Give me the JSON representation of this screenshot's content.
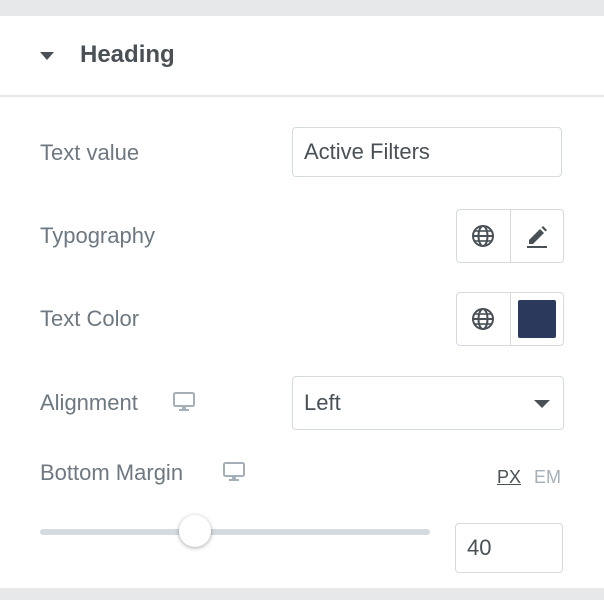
{
  "section": {
    "title": "Heading"
  },
  "controls": {
    "text_value": {
      "label": "Text value",
      "value": "Active Filters"
    },
    "typography": {
      "label": "Typography"
    },
    "text_color": {
      "label": "Text Color",
      "color": "#2b3a5c"
    },
    "alignment": {
      "label": "Alignment",
      "value": "Left"
    },
    "bottom_margin": {
      "label": "Bottom Margin",
      "units": [
        "PX",
        "EM"
      ],
      "active_unit": "PX",
      "value": "40",
      "slider_fraction": 0.4
    }
  },
  "icons": {
    "section_toggle": "caret-down-icon",
    "globe": "globe-icon",
    "edit": "pencil-icon",
    "responsive": "desktop-icon",
    "dropdown": "chevron-down-icon"
  },
  "colors": {
    "panel_bg": "#ffffff",
    "page_bg": "#e6e8ea",
    "text": "#6d7882",
    "heading": "#495157",
    "swatch": "#2b3a5c"
  }
}
